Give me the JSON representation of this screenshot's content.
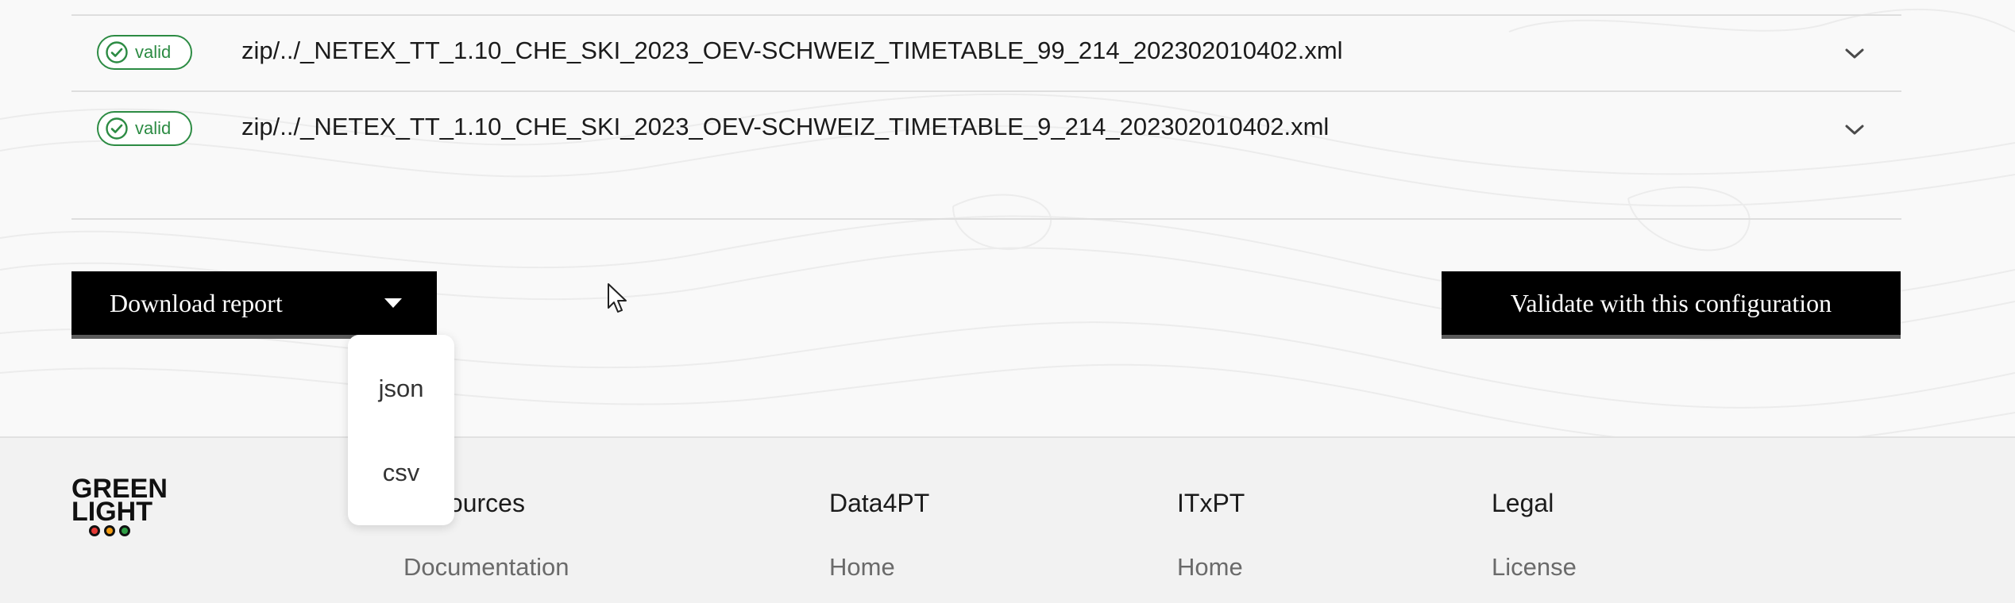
{
  "results": {
    "rows": [
      {
        "status": "valid",
        "filename": "zip/../_NETEX_TT_1.10_CHE_SKI_2023_OEV-SCHWEIZ_TIMETABLE_99_214_202302010402.xml"
      },
      {
        "status": "valid",
        "filename": "zip/../_NETEX_TT_1.10_CHE_SKI_2023_OEV-SCHWEIZ_TIMETABLE_9_214_202302010402.xml"
      }
    ]
  },
  "actions": {
    "download_label": "Download report",
    "download_options": [
      "json",
      "csv"
    ],
    "validate_label": "Validate with this configuration"
  },
  "footer": {
    "logo": {
      "line1": "GREEN",
      "line2": "LIGHT",
      "dot_colors": [
        "#e53935",
        "#f39c12",
        "#2e9e44"
      ]
    },
    "columns": [
      {
        "heading": "Resources",
        "link": "Documentation"
      },
      {
        "heading": "Data4PT",
        "link": "Home"
      },
      {
        "heading": "ITxPT",
        "link": "Home"
      },
      {
        "heading": "Legal",
        "link": "License"
      }
    ]
  },
  "colors": {
    "valid": "#2c8b43",
    "button_bg": "#000000",
    "page_bg": "#f9f9f9",
    "footer_bg": "#f2f2f2"
  }
}
